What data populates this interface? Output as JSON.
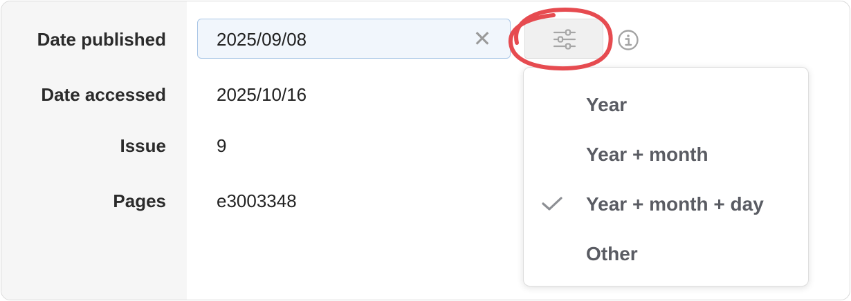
{
  "fields": {
    "date_published": {
      "label": "Date published",
      "value": "2025/09/08"
    },
    "date_accessed": {
      "label": "Date accessed",
      "value": "2025/10/16"
    },
    "issue": {
      "label": "Issue",
      "value": "9"
    },
    "pages": {
      "label": "Pages",
      "value": "e3003348"
    }
  },
  "controls": {
    "clear_glyph": "✕",
    "filter_icon": "sliders-icon",
    "info_icon": "info-icon",
    "highlight_color": "#e64b50"
  },
  "date_format_menu": {
    "items": [
      {
        "label": "Year",
        "checked": false
      },
      {
        "label": "Year + month",
        "checked": false
      },
      {
        "label": "Year + month + day",
        "checked": true
      },
      {
        "label": "Other",
        "checked": false
      }
    ]
  }
}
